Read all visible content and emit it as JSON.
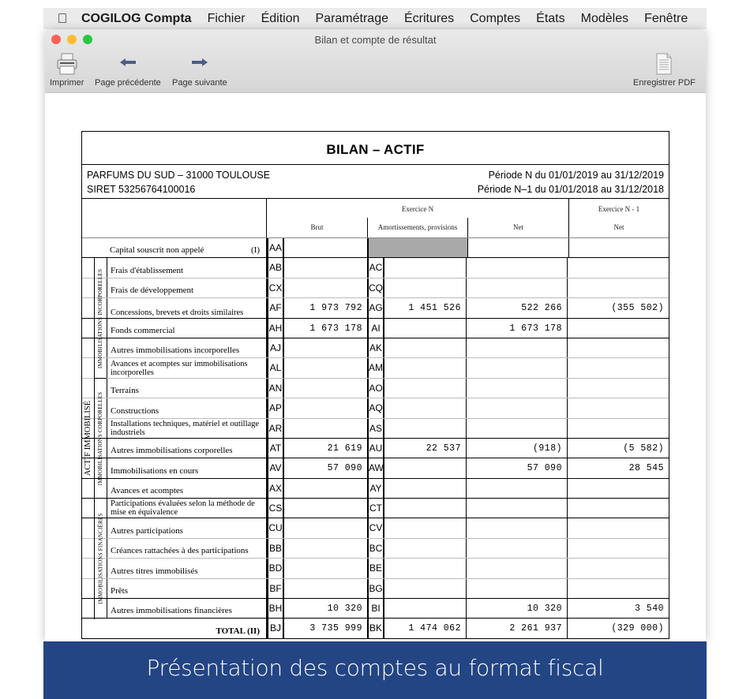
{
  "menubar": {
    "apple_icon": "apple-logo-icon",
    "app_name": "COGILOG Compta",
    "menus": [
      "Fichier",
      "Édition",
      "Paramétrage",
      "Écritures",
      "Comptes",
      "États",
      "Modèles",
      "Fenêtre"
    ]
  },
  "window": {
    "title": "Bilan et compte de résultat",
    "toolbar": {
      "print": {
        "label": "Imprimer",
        "icon": "printer-icon"
      },
      "prev": {
        "label": "Page précédente",
        "icon": "arrow-left-icon"
      },
      "next": {
        "label": "Page suivante",
        "icon": "arrow-right-icon"
      },
      "pdf": {
        "label": "Enregistrer PDF",
        "icon": "document-icon"
      }
    }
  },
  "form": {
    "title": "BILAN – ACTIF",
    "company": "PARFUMS DU SUD – 31000 TOULOUSE",
    "siret": "SIRET 53256764100016",
    "period_n": "Période N du 01/01/2019 au 31/12/2019",
    "period_n1": "Période N–1 du 01/01/2018 au 31/12/2018",
    "headers": {
      "exercice_n": "Exercice N",
      "exercice_n1": "Exercice N - 1",
      "brut": "Brut",
      "amort": "Amortissements, provisions",
      "net": "Net",
      "net_prev": "Net"
    },
    "main_group": "ACTIF IMMOBILISÉ",
    "groups": {
      "incorporelles": "IMMOBILISATIONS INCORPORELLES",
      "corporelles": "IMMOBILISATIONS CORPORELLES",
      "financieres": "IMMOBILISATIONS FINANCIÈRES"
    },
    "capital_row": {
      "label": "Capital souscrit non appelé",
      "suffix": "(I)",
      "code": "AA",
      "brut": "",
      "net": "",
      "prev": ""
    },
    "rows": [
      {
        "label": "Frais d'établissement",
        "code1": "AB",
        "brut": "",
        "code2": "AC",
        "amort": "",
        "net": "",
        "prev": ""
      },
      {
        "label": "Frais de développement",
        "code1": "CX",
        "brut": "",
        "code2": "CQ",
        "amort": "",
        "net": "",
        "prev": ""
      },
      {
        "label": "Concessions, brevets et droits similaires",
        "code1": "AF",
        "brut": "1 973 792",
        "code2": "AG",
        "amort": "1 451 526",
        "net": "522 266",
        "prev": "(355 502)"
      },
      {
        "label": "Fonds commercial",
        "code1": "AH",
        "brut": "1 673 178",
        "code2": "AI",
        "amort": "",
        "net": "1 673 178",
        "prev": ""
      },
      {
        "label": "Autres immobilisations incorporelles",
        "code1": "AJ",
        "brut": "",
        "code2": "AK",
        "amort": "",
        "net": "",
        "prev": ""
      },
      {
        "label": "Avances et acomptes sur immobilisations incorporelles",
        "code1": "AL",
        "brut": "",
        "code2": "AM",
        "amort": "",
        "net": "",
        "prev": ""
      },
      {
        "label": "Terrains",
        "code1": "AN",
        "brut": "",
        "code2": "AO",
        "amort": "",
        "net": "",
        "prev": ""
      },
      {
        "label": "Constructions",
        "code1": "AP",
        "brut": "",
        "code2": "AQ",
        "amort": "",
        "net": "",
        "prev": ""
      },
      {
        "label": "Installations techniques, matériel et outillage industriels",
        "code1": "AR",
        "brut": "",
        "code2": "AS",
        "amort": "",
        "net": "",
        "prev": ""
      },
      {
        "label": "Autres immobilisations corporelles",
        "code1": "AT",
        "brut": "21 619",
        "code2": "AU",
        "amort": "22 537",
        "net": "(918)",
        "prev": "(5 582)"
      },
      {
        "label": "Immobilisations en cours",
        "code1": "AV",
        "brut": "57 090",
        "code2": "AW",
        "amort": "",
        "net": "57 090",
        "prev": "28 545"
      },
      {
        "label": "Avances et acomptes",
        "code1": "AX",
        "brut": "",
        "code2": "AY",
        "amort": "",
        "net": "",
        "prev": ""
      },
      {
        "label": "Participations évaluées selon la méthode de mise en équivalence",
        "code1": "CS",
        "brut": "",
        "code2": "CT",
        "amort": "",
        "net": "",
        "prev": ""
      },
      {
        "label": "Autres participations",
        "code1": "CU",
        "brut": "",
        "code2": "CV",
        "amort": "",
        "net": "",
        "prev": ""
      },
      {
        "label": "Créances rattachées à des participations",
        "code1": "BB",
        "brut": "",
        "code2": "BC",
        "amort": "",
        "net": "",
        "prev": ""
      },
      {
        "label": "Autres titres immobilisés",
        "code1": "BD",
        "brut": "",
        "code2": "BE",
        "amort": "",
        "net": "",
        "prev": ""
      },
      {
        "label": "Prêts",
        "code1": "BF",
        "brut": "",
        "code2": "BG",
        "amort": "",
        "net": "",
        "prev": ""
      },
      {
        "label": "Autres immobilisations financières",
        "code1": "BH",
        "brut": "10 320",
        "code2": "BI",
        "amort": "",
        "net": "10 320",
        "prev": "3 540"
      }
    ],
    "total_row": {
      "label": "TOTAL (II)",
      "code1": "BJ",
      "brut": "3 735 999",
      "code2": "BK",
      "amort": "1 474 062",
      "net": "2 261 937",
      "prev": "(329 000)"
    }
  },
  "banner": {
    "text": "Présentation des comptes au format fiscal"
  },
  "colors": {
    "banner": "#234584",
    "shaded_cell": "#a9a9a9"
  }
}
